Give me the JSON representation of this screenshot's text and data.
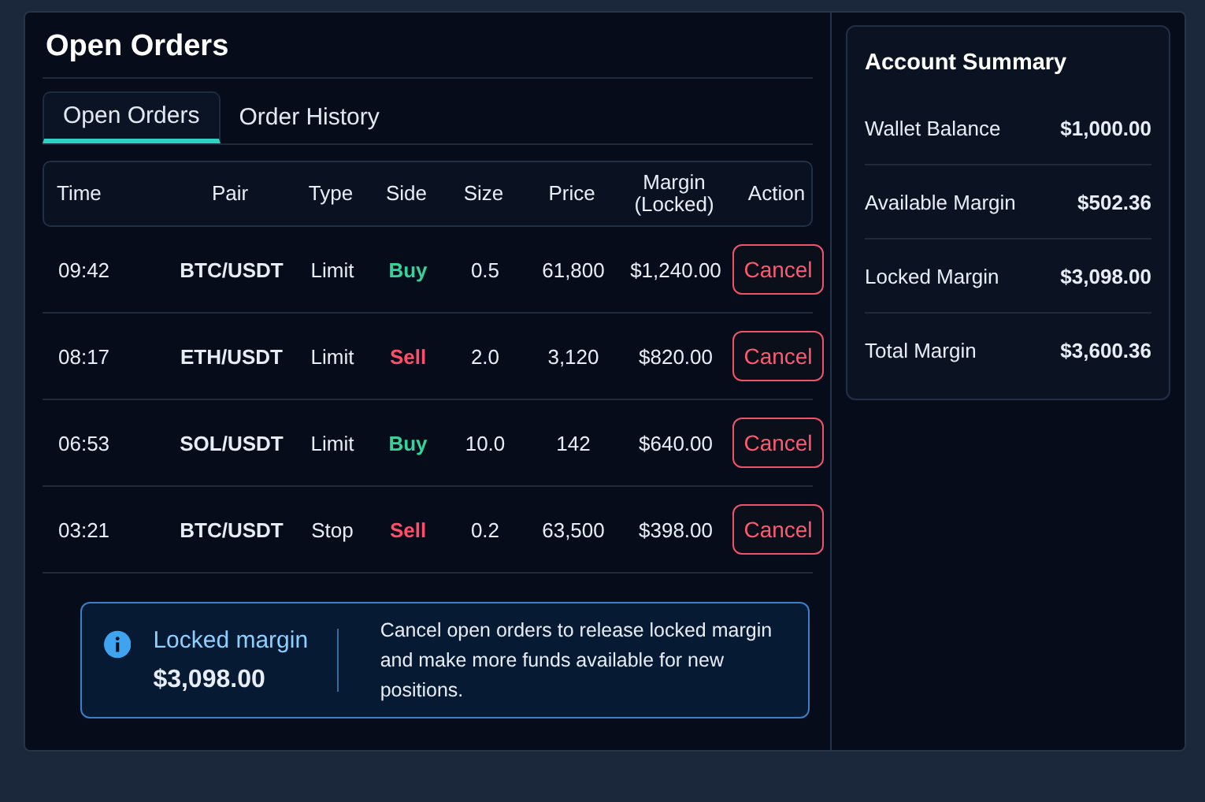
{
  "title": "Open Orders",
  "tabs": [
    {
      "label": "Open Orders",
      "selected": true
    },
    {
      "label": "Order History",
      "selected": false
    }
  ],
  "table": {
    "columns": [
      "Time",
      "Pair",
      "Type",
      "Side",
      "Size",
      "Price",
      "Margin\n(Locked)",
      "Action"
    ],
    "rows": [
      {
        "time": "09:42",
        "pair": "BTC/USDT",
        "type": "Limit",
        "side": "Buy",
        "kind": "buy",
        "size": "0.5",
        "price": "61,800",
        "margin": "$1,240.00",
        "action": "Cancel"
      },
      {
        "time": "08:17",
        "pair": "ETH/USDT",
        "type": "Limit",
        "side": "Sell",
        "kind": "sell",
        "size": "2.0",
        "price": "3,120",
        "margin": "$820.00",
        "action": "Cancel"
      },
      {
        "time": "06:53",
        "pair": "SOL/USDT",
        "type": "Limit",
        "side": "Buy",
        "kind": "buy",
        "size": "10.0",
        "price": "142",
        "margin": "$640.00",
        "action": "Cancel"
      },
      {
        "time": "03:21",
        "pair": "BTC/USDT",
        "type": "Stop",
        "side": "Sell",
        "kind": "sell",
        "size": "0.2",
        "price": "63,500",
        "margin": "$398.00",
        "action": "Cancel"
      }
    ]
  },
  "notice": {
    "label": "Locked margin",
    "amount": "$3,098.00",
    "message": "Cancel open orders to release locked margin and make more funds available for new positions."
  },
  "summary": {
    "title": "Account Summary",
    "items": [
      {
        "label": "Wallet Balance",
        "value": "$1,000.00"
      },
      {
        "label": "Available Margin",
        "value": "$502.36"
      },
      {
        "label": "Locked Margin",
        "value": "$3,098.00"
      },
      {
        "label": "Total Margin",
        "value": "$3,600.36"
      }
    ]
  }
}
